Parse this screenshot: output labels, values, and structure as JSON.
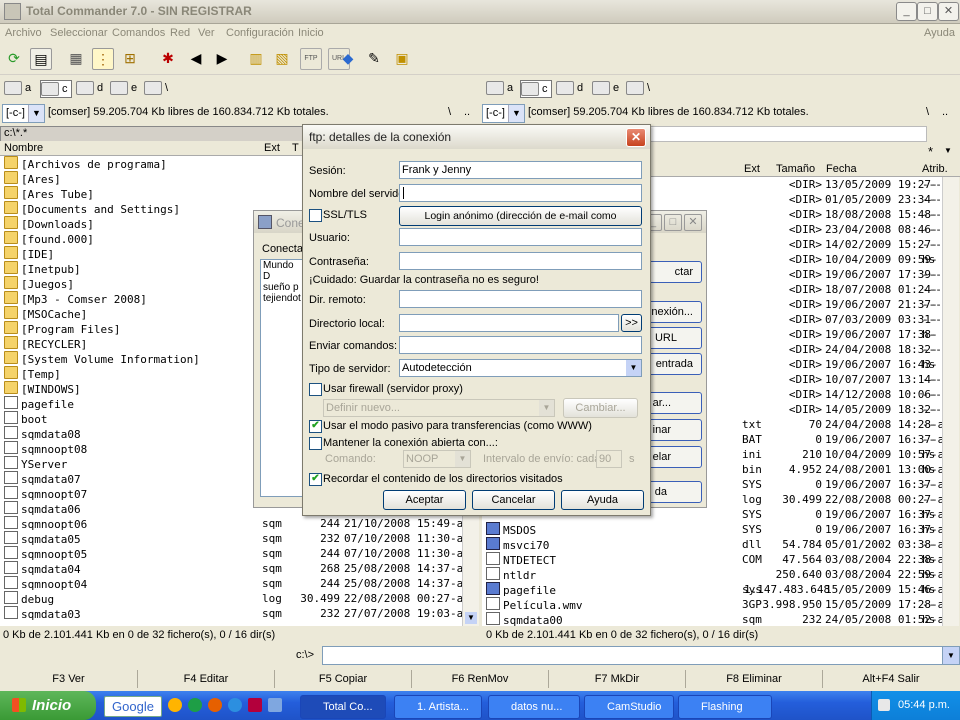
{
  "window": {
    "title": "Total Commander 7.0 - SIN REGISTRAR"
  },
  "menu": {
    "items": [
      "Archivo",
      "Seleccionar",
      "Comandos",
      "Red",
      "Ver",
      "Configuración",
      "Inicio"
    ],
    "help": "Ayuda"
  },
  "drives": {
    "a": "a",
    "c": "c",
    "d": "d",
    "e": "e",
    "net": "\\"
  },
  "left": {
    "drive_combo": "[-c-]",
    "info": "[comser]  59.205.704 Kb libres de 160.834.712 Kb totales.",
    "root_btn": "\\",
    "up_btn": "..",
    "path": "c:\\*.*",
    "columns": {
      "name": "Nombre",
      "ext": "Ext",
      "size": "Tamaño",
      "date": "Fecha"
    },
    "rows": [
      {
        "name": "[Archivos de programa]",
        "ext": "",
        "size": "",
        "date": "",
        "icon": "folder"
      },
      {
        "name": "[Ares]",
        "ext": "",
        "size": "",
        "date": "",
        "icon": "folder"
      },
      {
        "name": "[Ares Tube]",
        "ext": "",
        "size": "",
        "date": "",
        "icon": "folder"
      },
      {
        "name": "[Documents and Settings]",
        "ext": "",
        "size": "",
        "date": "",
        "icon": "folder"
      },
      {
        "name": "[Downloads]",
        "ext": "",
        "size": "",
        "date": "",
        "icon": "folder"
      },
      {
        "name": "[found.000]",
        "ext": "",
        "size": "",
        "date": "",
        "icon": "folder"
      },
      {
        "name": "[IDE]",
        "ext": "",
        "size": "",
        "date": "",
        "icon": "folder"
      },
      {
        "name": "[Inetpub]",
        "ext": "",
        "size": "",
        "date": "",
        "icon": "folder"
      },
      {
        "name": "[Juegos]",
        "ext": "",
        "size": "",
        "date": "",
        "icon": "folder"
      },
      {
        "name": "[Mp3 - Comser 2008]",
        "ext": "",
        "size": "",
        "date": "",
        "icon": "folder"
      },
      {
        "name": "[MSOCache]",
        "ext": "",
        "size": "",
        "date": "",
        "icon": "folder"
      },
      {
        "name": "[Program Files]",
        "ext": "",
        "size": "",
        "date": "",
        "icon": "folder"
      },
      {
        "name": "[RECYCLER]",
        "ext": "",
        "size": "",
        "date": "",
        "icon": "folder"
      },
      {
        "name": "[System Volume Information]",
        "ext": "",
        "size": "",
        "date": "",
        "icon": "folder"
      },
      {
        "name": "[Temp]",
        "ext": "",
        "size": "",
        "date": "",
        "icon": "folder"
      },
      {
        "name": "[WINDOWS]",
        "ext": "",
        "size": "",
        "date": "",
        "icon": "folder"
      },
      {
        "name": "pagefile",
        "ext": "",
        "size": "",
        "date": "",
        "icon": "file"
      },
      {
        "name": "boot",
        "ext": "",
        "size": "",
        "date": "",
        "icon": "file"
      },
      {
        "name": "sqmdata08",
        "ext": "",
        "size": "",
        "date": "",
        "icon": "file"
      },
      {
        "name": "sqmnoopt08",
        "ext": "",
        "size": "",
        "date": "",
        "icon": "file"
      },
      {
        "name": "YServer",
        "ext": "",
        "size": "",
        "date": "",
        "icon": "file"
      },
      {
        "name": "sqmdata07",
        "ext": "",
        "size": "",
        "date": "",
        "icon": "file"
      },
      {
        "name": "sqmnoopt07",
        "ext": "",
        "size": "",
        "date": "",
        "icon": "file"
      },
      {
        "name": "sqmdata06",
        "ext": "",
        "size": "",
        "date": "",
        "icon": "file"
      },
      {
        "name": "sqmnoopt06",
        "ext": "sqm",
        "size": "244",
        "date": "21/10/2008 15:49-ah-",
        "icon": "file"
      },
      {
        "name": "sqmdata05",
        "ext": "sqm",
        "size": "232",
        "date": "07/10/2008 11:30-ah-",
        "icon": "file"
      },
      {
        "name": "sqmnoopt05",
        "ext": "sqm",
        "size": "244",
        "date": "07/10/2008 11:30-ah-",
        "icon": "file"
      },
      {
        "name": "sqmdata04",
        "ext": "sqm",
        "size": "268",
        "date": "25/08/2008 14:37-ah-",
        "icon": "file"
      },
      {
        "name": "sqmnoopt04",
        "ext": "sqm",
        "size": "244",
        "date": "25/08/2008 14:37-ah-",
        "icon": "file"
      },
      {
        "name": "debug",
        "ext": "log",
        "size": "30.499",
        "date": "22/08/2008 00:27-a--",
        "icon": "file"
      },
      {
        "name": "sqmdata03",
        "ext": "sqm",
        "size": "232",
        "date": "27/07/2008 19:03-ah-",
        "icon": "file"
      }
    ],
    "status": "0 Kb de 2.101.441 Kb en 0 de 32 fichero(s), 0 / 16 dir(s)"
  },
  "right": {
    "drive_combo": "[-c-]",
    "info": "[comser]  59.205.704 Kb libres de 160.834.712 Kb totales.",
    "root_btn": "\\",
    "up_btn": "..",
    "star": "*",
    "columns": {
      "ext": "Ext",
      "size": "Tamaño",
      "date": "Fecha",
      "attr": "Atrib."
    },
    "rows": [
      {
        "name": "",
        "ext": "",
        "size": "<DIR>",
        "date": "13/05/2009 19:27-",
        "attr": "---",
        "icon": ""
      },
      {
        "name": "",
        "ext": "",
        "size": "<DIR>",
        "date": "01/05/2009 23:34-",
        "attr": "---",
        "icon": ""
      },
      {
        "name": "",
        "ext": "",
        "size": "<DIR>",
        "date": "18/08/2008 15:48-",
        "attr": "---",
        "icon": ""
      },
      {
        "name": "",
        "ext": "",
        "size": "<DIR>",
        "date": "23/04/2008 08:46-",
        "attr": "---",
        "icon": ""
      },
      {
        "name": "",
        "ext": "",
        "size": "<DIR>",
        "date": "14/02/2009 15:27-",
        "attr": "---",
        "icon": ""
      },
      {
        "name": "",
        "ext": "",
        "size": "<DIR>",
        "date": "10/04/2009 09:59-",
        "attr": "hs",
        "icon": ""
      },
      {
        "name": "",
        "ext": "",
        "size": "<DIR>",
        "date": "19/06/2007 17:39-",
        "attr": "---",
        "icon": ""
      },
      {
        "name": "",
        "ext": "",
        "size": "<DIR>",
        "date": "18/07/2008 01:24-",
        "attr": "---",
        "icon": ""
      },
      {
        "name": "",
        "ext": "",
        "size": "<DIR>",
        "date": "19/06/2007 21:37-",
        "attr": "---",
        "icon": ""
      },
      {
        "name": "",
        "ext": "",
        "size": "<DIR>",
        "date": "07/03/2009 03:31-",
        "attr": "---",
        "icon": ""
      },
      {
        "name": "",
        "ext": "",
        "size": "<DIR>",
        "date": "19/06/2007 17:38-",
        "attr": "h-",
        "icon": ""
      },
      {
        "name": "",
        "ext": "",
        "size": "<DIR>",
        "date": "24/04/2008 18:32-",
        "attr": "---",
        "icon": ""
      },
      {
        "name": "",
        "ext": "",
        "size": "<DIR>",
        "date": "19/06/2007 16:43-",
        "attr": "hs",
        "icon": ""
      },
      {
        "name": "",
        "ext": "",
        "size": "<DIR>",
        "date": "10/07/2007 13:14-",
        "attr": "---",
        "icon": ""
      },
      {
        "name": "",
        "ext": "",
        "size": "<DIR>",
        "date": "14/12/2008 10:06-",
        "attr": "---",
        "icon": ""
      },
      {
        "name": "",
        "ext": "",
        "size": "<DIR>",
        "date": "14/05/2009 18:32-",
        "attr": "---",
        "icon": ""
      },
      {
        "name": "",
        "ext": "txt",
        "size": "70",
        "date": "24/04/2008 14:28-a",
        "attr": "--",
        "icon": ""
      },
      {
        "name": "",
        "ext": "BAT",
        "size": "0",
        "date": "19/06/2007 16:37-a",
        "attr": "--",
        "icon": ""
      },
      {
        "name": "",
        "ext": "ini",
        "size": "210",
        "date": "10/04/2009 10:57-a",
        "attr": "hs",
        "icon": ""
      },
      {
        "name": "",
        "ext": "bin",
        "size": "4.952",
        "date": "24/08/2001 13:00-a",
        "attr": "hs",
        "icon": ""
      },
      {
        "name": "",
        "ext": "SYS",
        "size": "0",
        "date": "19/06/2007 16:37-a",
        "attr": "--",
        "icon": ""
      },
      {
        "name": "",
        "ext": "log",
        "size": "30.499",
        "date": "22/08/2008 00:27-a",
        "attr": "--",
        "icon": ""
      },
      {
        "name": "",
        "ext": "SYS",
        "size": "0",
        "date": "19/06/2007 16:37-a",
        "attr": "hs",
        "icon": ""
      },
      {
        "name": "MSDOS",
        "ext": "SYS",
        "size": "0",
        "date": "19/06/2007 16:37-a",
        "attr": "hs",
        "icon": "app"
      },
      {
        "name": "msvci70",
        "ext": "dll",
        "size": "54.784",
        "date": "05/01/2002 03:38-a",
        "attr": "--",
        "icon": "app"
      },
      {
        "name": "NTDETECT",
        "ext": "COM",
        "size": "47.564",
        "date": "03/08/2004 22:38-a",
        "attr": "hs",
        "icon": "file"
      },
      {
        "name": "ntldr",
        "ext": "",
        "size": "250.640",
        "date": "03/08/2004 22:59-a",
        "attr": "hs",
        "icon": "file"
      },
      {
        "name": "pagefile",
        "ext": "sys",
        "size": "1.147.483.648",
        "date": "15/05/2009 15:46-a",
        "attr": "hs",
        "icon": "app"
      },
      {
        "name": "Película.wmv",
        "ext": "3GP",
        "size": "3.998.950",
        "date": "15/05/2009 17:28-a",
        "attr": "--",
        "icon": "file"
      },
      {
        "name": "sqmdata00",
        "ext": "sqm",
        "size": "232",
        "date": "24/05/2008 01:52-a",
        "attr": "hs",
        "icon": "file"
      }
    ],
    "status": "0 Kb de 2.101.441 Kb en 0 de 32 fichero(s), 0 / 16 dir(s)"
  },
  "cmdline": {
    "prompt": "c:\\>",
    "value": ""
  },
  "fkeys": [
    "F3 Ver",
    "F4 Editar",
    "F5 Copiar",
    "F6 RenMov",
    "F7 MkDir",
    "F8 Eliminar",
    "Alt+F4 Salir"
  ],
  "bg_dialog": {
    "title": "Cone",
    "group_label": "Conecta",
    "list_text": [
      "Mundo D",
      "sueño p",
      "tejiendot"
    ],
    "buttons": [
      "ctar",
      "nexión...",
      "URL",
      "entrada",
      "ar...",
      "inar",
      "elar",
      "da"
    ]
  },
  "ftp_dialog": {
    "title": "ftp: detalles de la conexión",
    "session_label": "Sesión:",
    "session_value": "Frank y Jenny",
    "server_label": "Nombre del servidor:",
    "server_value": "",
    "ssl_label": "SSL/TLS",
    "ssl_checked": false,
    "anon_button": "Login anónimo (dirección de e-mail como contraseña)",
    "user_label": "Usuario:",
    "user_value": "",
    "pass_label": "Contraseña:",
    "pass_value": "",
    "warning": "¡Cuidado: Guardar la contraseña no es seguro!",
    "remote_label": "Dir. remoto:",
    "remote_value": "",
    "local_label": "Directorio local:",
    "local_value": "",
    "local_browse": ">>",
    "send_label": "Enviar comandos:",
    "send_value": "",
    "server_type_label": "Tipo de servidor:",
    "server_type_value": "Autodetección",
    "firewall_label": "Usar firewall (servidor proxy)",
    "firewall_checked": false,
    "firewall_define": "Definir nuevo...",
    "firewall_change": "Cambiar...",
    "passive_label": "Usar el modo pasivo para transferencias (como WWW)",
    "passive_checked": true,
    "keepalive_label": "Mantener la conexión abierta con...:",
    "keepalive_checked": false,
    "command_label": "Comando:",
    "command_value": "NOOP",
    "interval_label": "Intervalo de envío: cada",
    "interval_value": "90",
    "interval_unit": "s",
    "remember_label": "Recordar el contenido de los directorios visitados",
    "remember_checked": true,
    "ok": "Aceptar",
    "cancel": "Cancelar",
    "help": "Ayuda"
  },
  "taskbar": {
    "start": "Inicio",
    "search": "Google",
    "tasks": [
      "Total Co...",
      "1. Artista...",
      "datos nu...",
      "CamStudio",
      "Flashing"
    ],
    "clock": "05:44 p.m."
  }
}
